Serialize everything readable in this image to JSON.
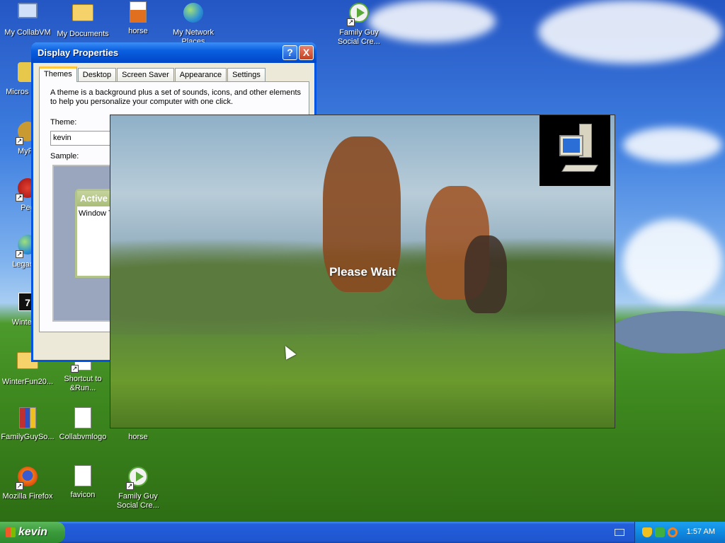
{
  "desktop": {
    "icons": [
      {
        "label": "My CollabVM",
        "icon": "my-computer-icon"
      },
      {
        "label": "My Documents",
        "icon": "my-documents-icon"
      },
      {
        "label": "horse",
        "icon": "image-file-icon"
      },
      {
        "label": "My Network Places",
        "icon": "network-places-icon"
      },
      {
        "label": "Family Guy Social Cre...",
        "icon": "media-shortcut-icon"
      },
      {
        "label": "Micros Outlo",
        "icon": "outlook-icon"
      },
      {
        "label": "MyPa",
        "icon": "program-shortcut-icon"
      },
      {
        "label": "Peg",
        "icon": "program-shortcut-icon"
      },
      {
        "label": "LegacyU",
        "icon": "update-shortcut-icon"
      },
      {
        "label": "WinterFu",
        "icon": "program-icon"
      },
      {
        "label": "WinterFun20...",
        "icon": "folder-icon"
      },
      {
        "label": "Shortcut to &Run...",
        "icon": "shortcut-icon"
      },
      {
        "label": "FamilyGuySo...",
        "icon": "archive-icon"
      },
      {
        "label": "Collabvmlogo",
        "icon": "image-file-icon"
      },
      {
        "label": "horse",
        "icon": "image-file-icon"
      },
      {
        "label": "Mozilla Firefox",
        "icon": "firefox-icon"
      },
      {
        "label": "favicon",
        "icon": "image-file-icon"
      },
      {
        "label": "Family Guy Social Cre...",
        "icon": "media-shortcut-icon"
      }
    ]
  },
  "dialog": {
    "title": "Display Properties",
    "help_button": "?",
    "close_button": "X",
    "tabs": [
      {
        "label": "Themes",
        "active": true
      },
      {
        "label": "Desktop",
        "active": false
      },
      {
        "label": "Screen Saver",
        "active": false
      },
      {
        "label": "Appearance",
        "active": false
      },
      {
        "label": "Settings",
        "active": false
      }
    ],
    "description": "A theme is a background plus a set of sounds, icons, and other elements to help you personalize your computer with one click.",
    "theme_label": "Theme:",
    "theme_value": "kevin",
    "sample_label": "Sample:",
    "sample_window_title": "Active W",
    "sample_window_text": "Window T"
  },
  "overlay": {
    "message": "Please Wait"
  },
  "taskbar": {
    "start_label": "kevin",
    "clock": "1:57 AM"
  }
}
